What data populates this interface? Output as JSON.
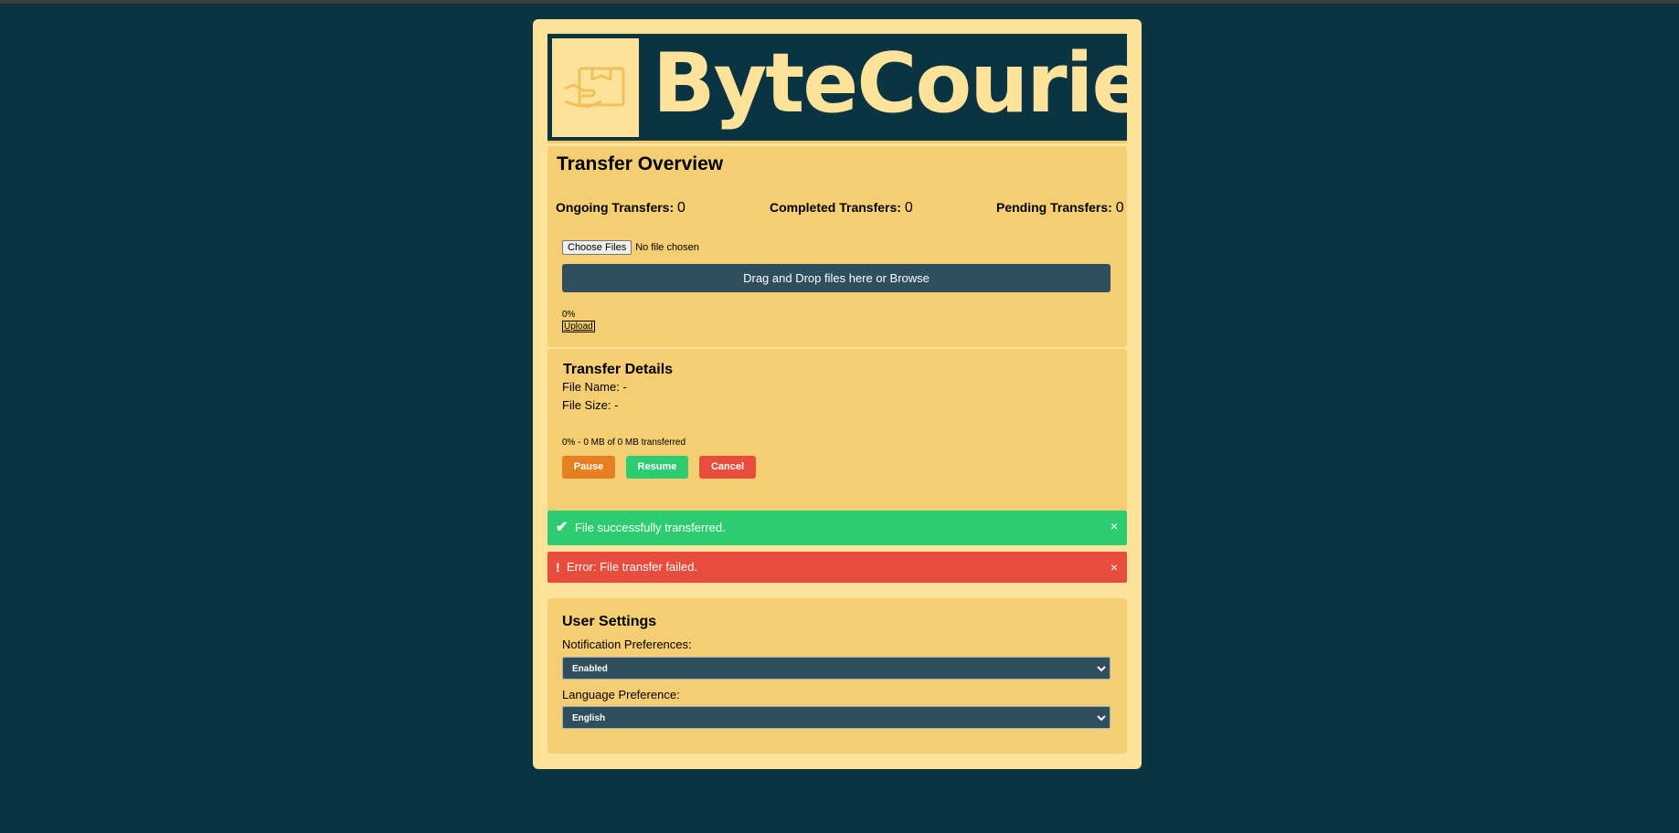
{
  "brand": {
    "name": "ByteCourier",
    "logo_icon": "package-hand-icon"
  },
  "overview": {
    "title": "Transfer Overview",
    "ongoing_label": "Ongoing Transfers:",
    "ongoing_value": "0",
    "completed_label": "Completed Transfers:",
    "completed_value": "0",
    "pending_label": "Pending Transfers:",
    "pending_value": "0"
  },
  "upload": {
    "choose_label": "Choose Files",
    "no_file_text": "No file chosen",
    "drop_text": "Drag and Drop files here or Browse",
    "progress_text": "0%",
    "progress_value": 0,
    "upload_label": "Upload"
  },
  "details": {
    "title": "Transfer Details",
    "file_name": "File Name: -",
    "file_size": "File Size: -",
    "progress_text": "0% - 0 MB of 0 MB transferred",
    "pause_label": "Pause",
    "resume_label": "Resume",
    "cancel_label": "Cancel"
  },
  "alerts": {
    "success_icon": "✔",
    "success_text": "File successfully transferred.",
    "error_icon": "!",
    "error_text": "Error: File transfer failed.",
    "close_glyph": "×"
  },
  "settings": {
    "title": "User Settings",
    "notification_label": "Notification Preferences:",
    "notification_value": "Enabled",
    "language_label": "Language Preference:",
    "language_value": "English"
  },
  "colors": {
    "background": "#0b3443",
    "card": "#fde39a",
    "panel": "#f5cd72",
    "control_dark": "#2f4f5f",
    "pause": "#e67e22",
    "success": "#2ecc71",
    "danger": "#e74c3c"
  }
}
